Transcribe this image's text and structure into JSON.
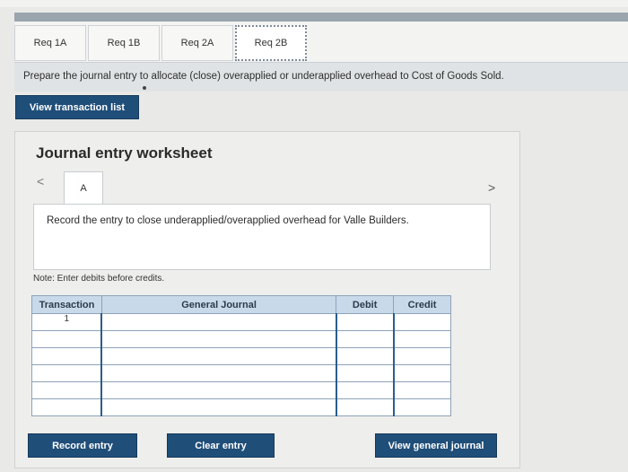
{
  "tabs": [
    {
      "label": "Req 1A"
    },
    {
      "label": "Req 1B"
    },
    {
      "label": "Req 2A"
    },
    {
      "label": "Req 2B"
    }
  ],
  "instruction": "Prepare the journal entry to allocate (close) overapplied or underapplied overhead to Cost of Goods Sold.",
  "buttons": {
    "view_transactions": "View transaction list",
    "record_entry": "Record entry",
    "clear_entry": "Clear entry",
    "view_general_journal": "View general journal"
  },
  "worksheet": {
    "title": "Journal entry worksheet",
    "entry_tab": "A",
    "entry_text": "Record the entry to close underapplied/overapplied overhead for Valle Builders.",
    "note": "Note: Enter debits before credits.",
    "prev": "<",
    "next": ">"
  },
  "table": {
    "headers": [
      "Transaction",
      "General Journal",
      "Debit",
      "Credit"
    ],
    "rows": [
      {
        "transaction": "1",
        "account": "",
        "debit": "",
        "credit": ""
      },
      {
        "transaction": "",
        "account": "",
        "debit": "",
        "credit": ""
      },
      {
        "transaction": "",
        "account": "",
        "debit": "",
        "credit": ""
      },
      {
        "transaction": "",
        "account": "",
        "debit": "",
        "credit": ""
      },
      {
        "transaction": "",
        "account": "",
        "debit": "",
        "credit": ""
      },
      {
        "transaction": "",
        "account": "",
        "debit": "",
        "credit": ""
      }
    ]
  },
  "colors": {
    "button_bg": "#1f4e79",
    "header_bg": "#c8d9ea",
    "top_rule": "#9aa5ae"
  }
}
